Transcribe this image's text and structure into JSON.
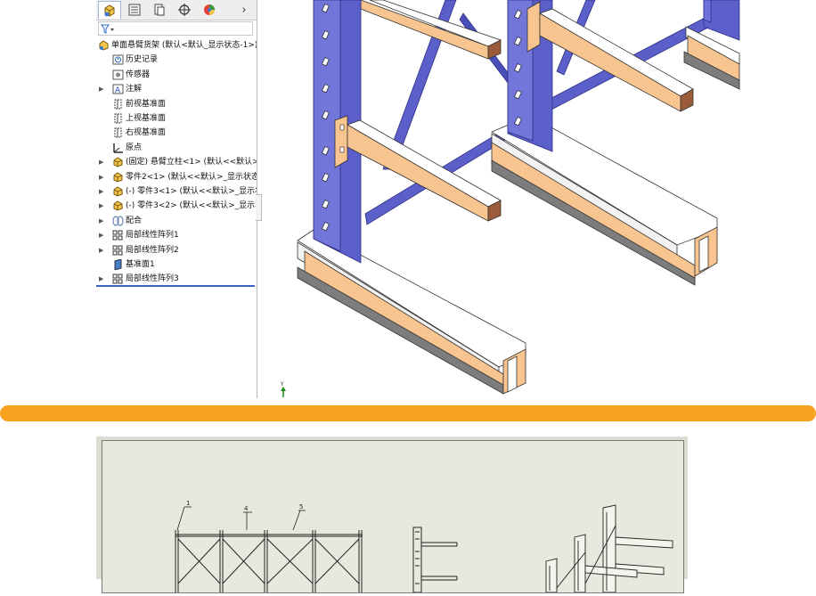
{
  "feature_manager": {
    "tabs": [
      {
        "icon": "feature-manager-tab-icon",
        "active": true
      },
      {
        "icon": "property-manager-tab-icon"
      },
      {
        "icon": "configuration-manager-tab-icon"
      },
      {
        "icon": "dimxpert-tab-icon"
      },
      {
        "icon": "display-manager-tab-icon"
      }
    ],
    "more_tabs_glyph": "›",
    "filter_icon": "filter-icon",
    "tree": [
      {
        "label": "单面悬臂货架 (默认<默认_显示状态-1>)",
        "icon": "assembly-icon",
        "expandable": false,
        "indent": 0
      },
      {
        "label": "历史记录",
        "icon": "history-icon",
        "expandable": false,
        "indent": 1
      },
      {
        "label": "传感器",
        "icon": "sensor-icon",
        "expandable": false,
        "indent": 1
      },
      {
        "label": "注解",
        "icon": "annotation-icon",
        "expandable": true,
        "indent": 1
      },
      {
        "label": "前视基准面",
        "icon": "plane-icon",
        "expandable": false,
        "indent": 1
      },
      {
        "label": "上视基准面",
        "icon": "plane-icon",
        "expandable": false,
        "indent": 1
      },
      {
        "label": "右视基准面",
        "icon": "plane-icon",
        "expandable": false,
        "indent": 1
      },
      {
        "label": "原点",
        "icon": "origin-icon",
        "expandable": false,
        "indent": 1
      },
      {
        "label": "(固定) 悬臂立柱<1> (默认<<默认>_显",
        "icon": "part-icon",
        "expandable": true,
        "indent": 1
      },
      {
        "label": "零件2<1> (默认<<默认>_显示状态 1",
        "icon": "part-icon",
        "expandable": true,
        "indent": 1
      },
      {
        "label": "(-) 零件3<1> (默认<<默认>_显示状态",
        "icon": "part-icon",
        "expandable": true,
        "indent": 1
      },
      {
        "label": "(-) 零件3<2> (默认<<默认>_显示状态",
        "icon": "part-icon",
        "expandable": true,
        "indent": 1
      },
      {
        "label": "配合",
        "icon": "mates-icon",
        "expandable": true,
        "indent": 1
      },
      {
        "label": "局部线性阵列1",
        "icon": "linear-pattern-icon",
        "expandable": true,
        "indent": 1
      },
      {
        "label": "局部线性阵列2",
        "icon": "linear-pattern-icon",
        "expandable": true,
        "indent": 1
      },
      {
        "label": "基准面1",
        "icon": "plane-solid-icon",
        "expandable": false,
        "indent": 1
      },
      {
        "label": "局部线性阵列3",
        "icon": "linear-pattern-icon",
        "expandable": true,
        "indent": 1
      }
    ]
  },
  "viewport": {
    "triad_axis_label": "Y"
  },
  "drawing": {
    "balloons": [
      "1",
      "4",
      "5"
    ]
  },
  "colors": {
    "column_blue": "#5b5fc9",
    "arm_orange": "#f8c48f",
    "divider_orange": "#f8a31f",
    "selection_blue": "#3d63c2"
  }
}
